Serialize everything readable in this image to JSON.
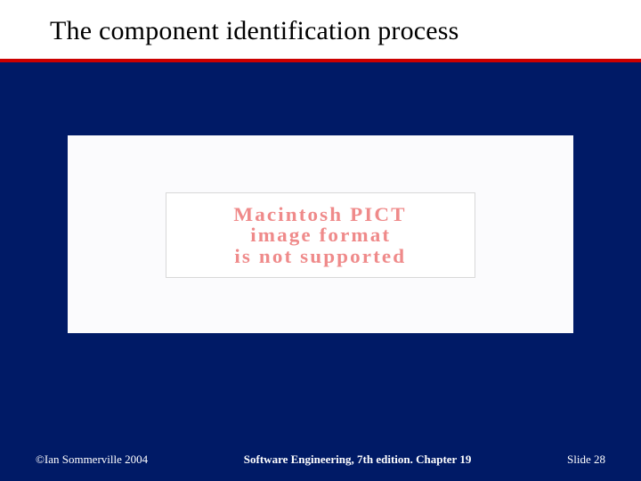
{
  "slide": {
    "title": "The component identification process",
    "error": {
      "line1": "Macintosh PICT",
      "line2": "image format",
      "line3": "is not supported"
    },
    "footer": {
      "copyright": "©Ian Sommerville 2004",
      "center": "Software Engineering, 7th edition. Chapter 19",
      "page_label": "Slide 28"
    }
  }
}
